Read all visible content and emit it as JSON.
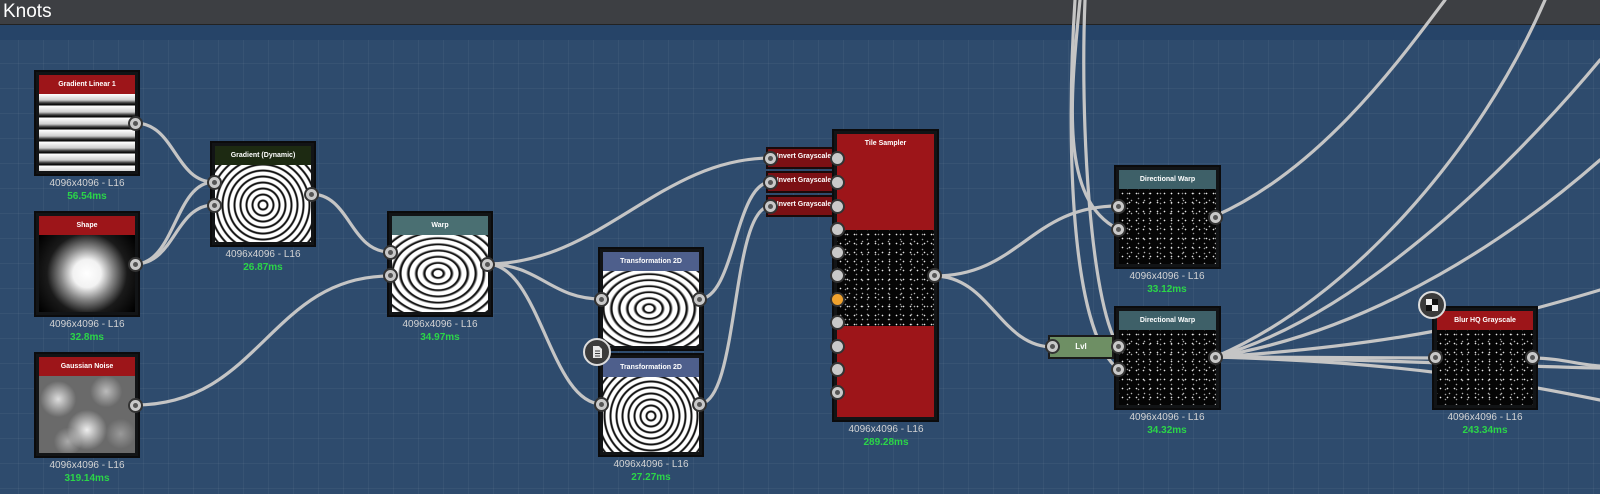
{
  "window": {
    "title": "Knots"
  },
  "nodes": {
    "gradient_linear": {
      "title": "Gradient Linear 1",
      "res": "4096x4096 - L16",
      "time": "56.54ms"
    },
    "shape": {
      "title": "Shape",
      "res": "4096x4096 - L16",
      "time": "32.8ms"
    },
    "gaussian_noise": {
      "title": "Gaussian Noise",
      "res": "4096x4096 - L16",
      "time": "319.14ms"
    },
    "gradient_dynamic": {
      "title": "Gradient (Dynamic)",
      "res": "4096x4096 - L16",
      "time": "26.87ms"
    },
    "warp": {
      "title": "Warp",
      "res": "4096x4096 - L16",
      "time": "34.97ms"
    },
    "transformation_1": {
      "title": "Transformation 2D"
    },
    "transformation_2": {
      "title": "Transformation 2D",
      "res": "4096x4096 - L16",
      "time": "27.27ms"
    },
    "invert_1": {
      "title": "Invert Grayscale"
    },
    "invert_2": {
      "title": "Invert Grayscale"
    },
    "invert_3": {
      "title": "Invert Grayscale"
    },
    "tile_sampler": {
      "title": "Tile Sampler",
      "res": "4096x4096 - L16",
      "time": "289.28ms"
    },
    "directional_warp_1": {
      "title": "Directional Warp",
      "res": "4096x4096 - L16",
      "time": "33.12ms"
    },
    "directional_warp_2": {
      "title": "Directional Warp",
      "res": "4096x4096 - L16",
      "time": "34.32ms"
    },
    "levels": {
      "title": "Lvl"
    },
    "blur_hq": {
      "title": "Blur HQ Grayscale",
      "res": "4096x4096 - L16",
      "time": "243.34ms"
    }
  },
  "colors": {
    "canvas": "#2e4b6d",
    "header_red": "#9d1519",
    "header_dark_green": "#1d2a12",
    "header_teal": "#4a6f72",
    "header_blue": "#4e5f8c",
    "header_slate": "#3e6068",
    "timing_green": "#2bd648",
    "link": "#c5c5c5"
  },
  "icons": {
    "comment": "document-icon",
    "cache": "checker-icon"
  }
}
